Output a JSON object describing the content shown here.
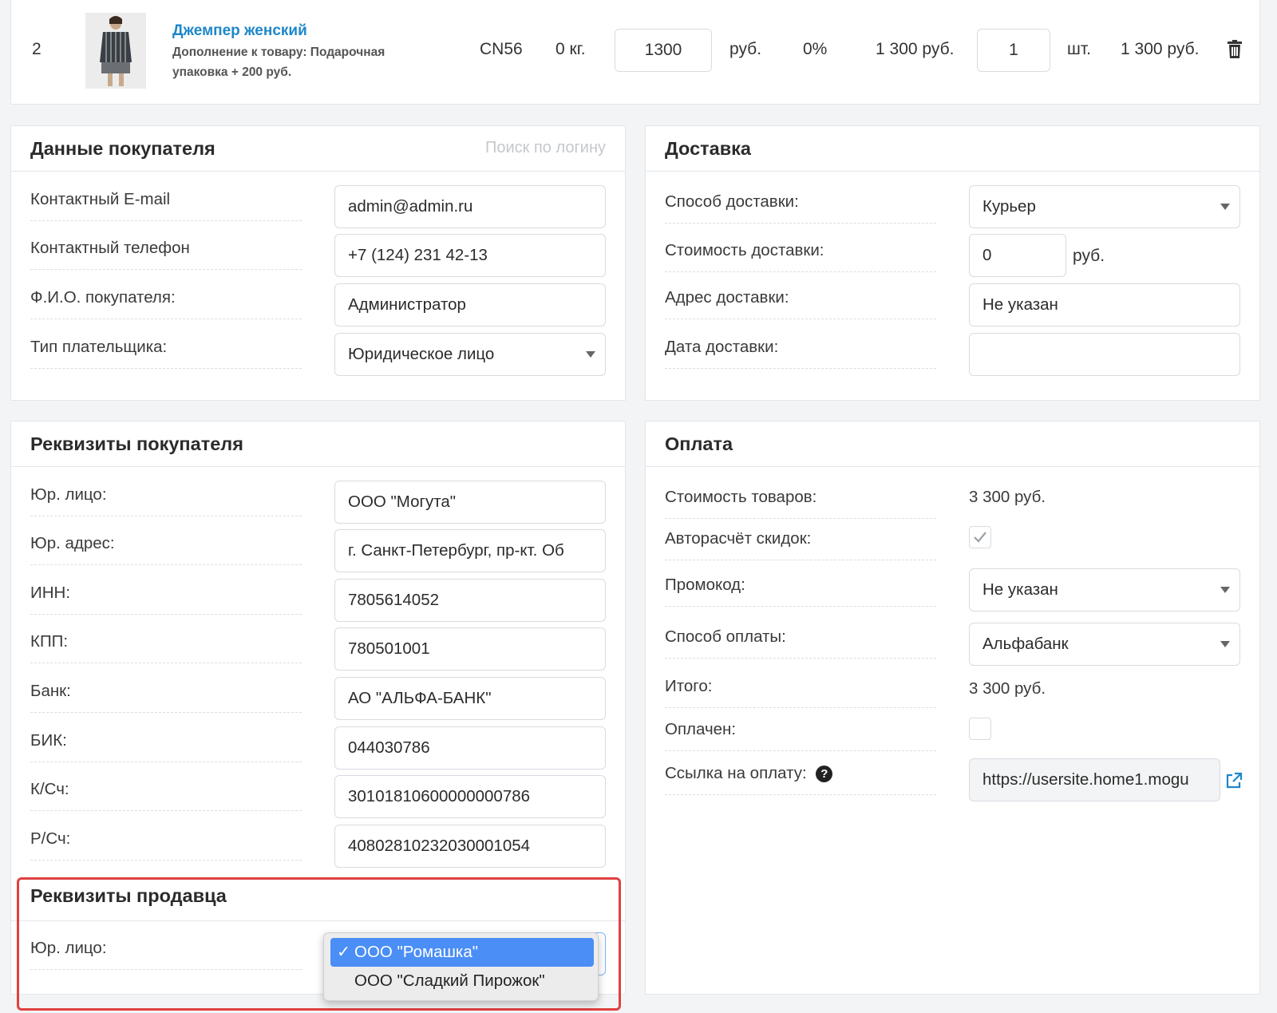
{
  "product": {
    "num": "2",
    "name": "Джемпер женский",
    "addon": "Дополнение к товару: Подарочная упаковка + 200 руб.",
    "code": "CN56",
    "weight": "0 кг.",
    "price": "1300",
    "price_unit": "руб.",
    "discount": "0%",
    "price_total": "1 300 руб.",
    "qty": "1",
    "qty_unit": "шт.",
    "sum": "1 300 руб."
  },
  "buyer": {
    "title": "Данные покупателя",
    "search_placeholder": "Поиск по логину",
    "email_label": "Контактный E-mail",
    "email": "admin@admin.ru",
    "phone_label": "Контактный телефон",
    "phone": "+7 (124) 231 42-13",
    "fio_label": "Ф.И.О. покупателя:",
    "fio": "Администратор",
    "payer_label": "Тип плательщика:",
    "payer": "Юридическое лицо"
  },
  "delivery": {
    "title": "Доставка",
    "method_label": "Способ доставки:",
    "method": "Курьер",
    "cost_label": "Стоимость доставки:",
    "cost": "0",
    "cost_unit": "руб.",
    "address_label": "Адрес доставки:",
    "address": "Не указан",
    "date_label": "Дата доставки:",
    "date": ""
  },
  "requisites": {
    "title": "Реквизиты покупателя",
    "rows": [
      {
        "label": "Юр. лицо:",
        "value": "ООО \"Могута\""
      },
      {
        "label": "Юр. адрес:",
        "value": "г. Санкт-Петербург, пр-кт. Об"
      },
      {
        "label": "ИНН:",
        "value": "7805614052"
      },
      {
        "label": "КПП:",
        "value": "780501001"
      },
      {
        "label": "Банк:",
        "value": "АО \"АЛЬФА-БАНК\""
      },
      {
        "label": "БИК:",
        "value": "044030786"
      },
      {
        "label": "К/Сч:",
        "value": "30101810600000000786"
      },
      {
        "label": "Р/Сч:",
        "value": "40802810232030001054"
      }
    ]
  },
  "seller": {
    "title": "Реквизиты продавца",
    "entity_label": "Юр. лицо:",
    "options": [
      "ООО \"Ромашка\"",
      "ООО \"Сладкий Пирожок\""
    ],
    "selected_index": 0
  },
  "payment": {
    "title": "Оплата",
    "goods_label": "Стоимость товаров:",
    "goods": "3 300 руб.",
    "autocalc_label": "Авторасчёт скидок:",
    "autocalc_checked": true,
    "promo_label": "Промокод:",
    "promo": "Не указан",
    "method_label": "Способ оплаты:",
    "method": "Альфабанк",
    "total_label": "Итого:",
    "total": "3 300 руб.",
    "paid_label": "Оплачен:",
    "paid_checked": false,
    "link_label": "Ссылка на оплату:",
    "link": "https://usersite.home1.mogu"
  }
}
